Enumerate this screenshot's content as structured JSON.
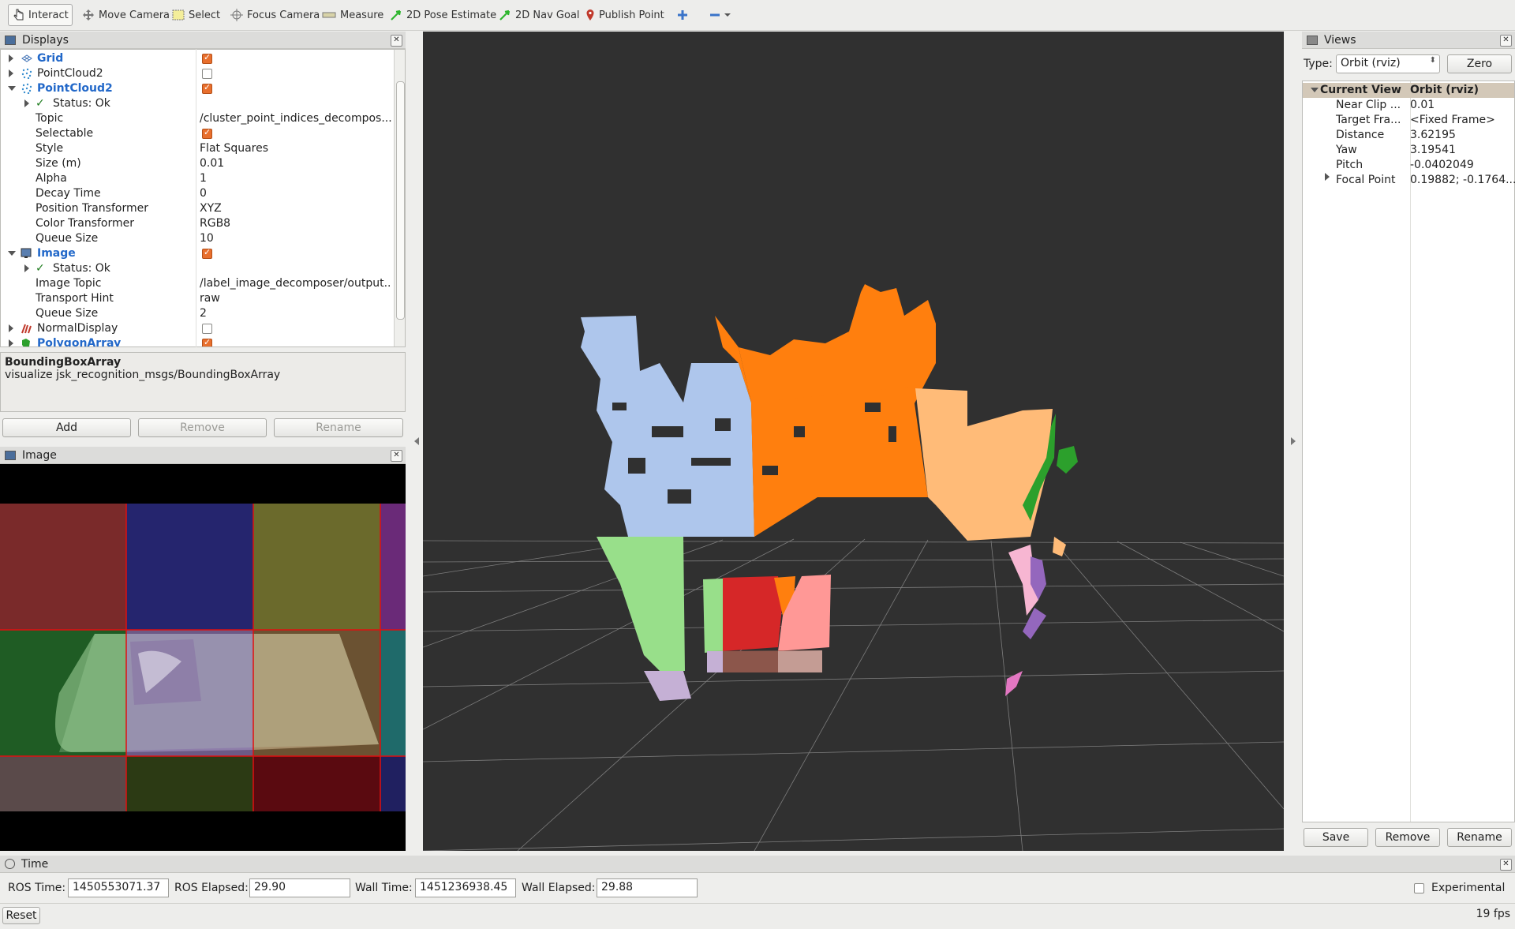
{
  "toolbar": {
    "tools": [
      "Interact",
      "Move Camera",
      "Select",
      "Focus Camera",
      "Measure",
      "2D Pose Estimate",
      "2D Nav Goal",
      "Publish Point"
    ]
  },
  "displays": {
    "title": "Displays",
    "items": [
      {
        "label": "Grid",
        "checked": true
      },
      {
        "label": "PointCloud2",
        "checked": false
      },
      {
        "label": "PointCloud2",
        "checked": true
      },
      {
        "label": "Status: Ok"
      },
      {
        "label": "Topic",
        "value": "/cluster_point_indices_decompos..."
      },
      {
        "label": "Selectable",
        "checked": true
      },
      {
        "label": "Style",
        "value": "Flat Squares"
      },
      {
        "label": "Size (m)",
        "value": "0.01"
      },
      {
        "label": "Alpha",
        "value": "1"
      },
      {
        "label": "Decay Time",
        "value": "0"
      },
      {
        "label": "Position Transformer",
        "value": "XYZ"
      },
      {
        "label": "Color Transformer",
        "value": "RGB8"
      },
      {
        "label": "Queue Size",
        "value": "10"
      },
      {
        "label": "Image",
        "checked": true
      },
      {
        "label": "Status: Ok"
      },
      {
        "label": "Image Topic",
        "value": "/label_image_decomposer/output..."
      },
      {
        "label": "Transport Hint",
        "value": "raw"
      },
      {
        "label": "Queue Size",
        "value": "2"
      },
      {
        "label": "NormalDisplay",
        "checked": false
      },
      {
        "label": "PolygonArray",
        "checked": true
      }
    ],
    "description_title": "BoundingBoxArray",
    "description_text": "visualize jsk_recognition_msgs/BoundingBoxArray",
    "buttons": {
      "add": "Add",
      "remove": "Remove",
      "rename": "Rename"
    }
  },
  "image_panel": {
    "title": "Image"
  },
  "views": {
    "title": "Views",
    "type_label": "Type:",
    "type_value": "Orbit (rviz)",
    "zero_button": "Zero",
    "header": {
      "name": "Current View",
      "value": "Orbit (rviz)"
    },
    "props": [
      {
        "label": "Near Clip ...",
        "value": "0.01"
      },
      {
        "label": "Target Fra...",
        "value": "<Fixed Frame>"
      },
      {
        "label": "Distance",
        "value": "3.62195"
      },
      {
        "label": "Yaw",
        "value": "3.19541"
      },
      {
        "label": "Pitch",
        "value": "-0.0402049"
      },
      {
        "label": "Focal Point",
        "value": "0.19882; -0.1764..."
      }
    ],
    "buttons": {
      "save": "Save",
      "remove": "Remove",
      "rename": "Rename"
    }
  },
  "time": {
    "title": "Time",
    "ros_time_label": "ROS Time:",
    "ros_time": "1450553071.37",
    "ros_elapsed_label": "ROS Elapsed:",
    "ros_elapsed": "29.90",
    "wall_time_label": "Wall Time:",
    "wall_time": "1451236938.45",
    "wall_elapsed_label": "Wall Elapsed:",
    "wall_elapsed": "29.88",
    "experimental_label": "Experimental",
    "reset_button": "Reset",
    "fps": "19 fps"
  }
}
